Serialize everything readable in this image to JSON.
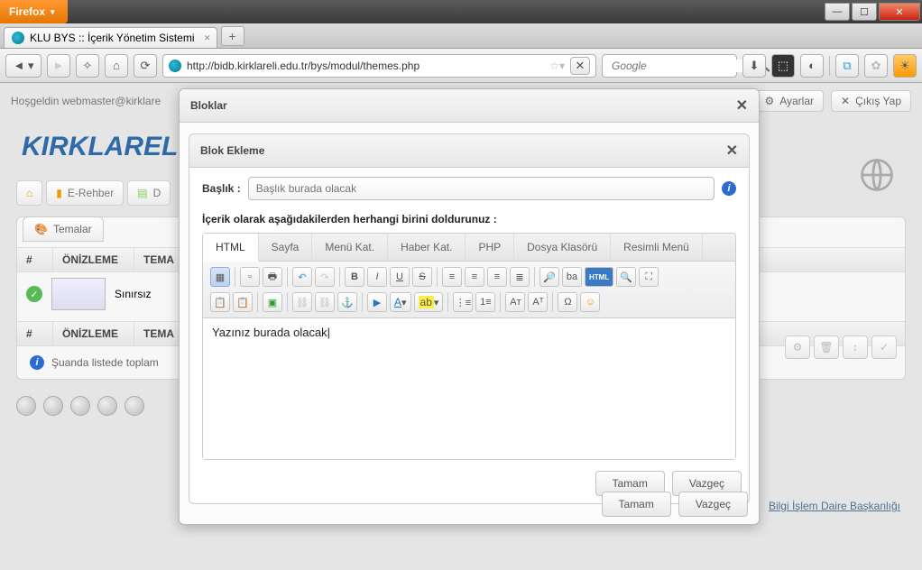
{
  "browser": {
    "name": "Firefox",
    "tab_title": "KLU BYS :: İçerik Yönetim Sistemi",
    "url": "http://bidb.kirklareli.edu.tr/bys/modul/themes.php",
    "search_placeholder": "Google"
  },
  "page": {
    "welcome": "Hoşgeldin webmaster@kirklare",
    "header_buttons": {
      "settings": "Ayarlar",
      "logout": "Çıkış Yap"
    },
    "brand": "KIRKLAREL",
    "nav": {
      "erehber": "E-Rehber",
      "d": "D"
    },
    "tab_label": "Temalar",
    "grid": {
      "cols": [
        "#",
        "ÖNİZLEME",
        "TEMA"
      ],
      "row_name": "Sınırsız"
    },
    "info": "Şuanda listede toplam",
    "footer_link": "Bilgi İşlem Daire Başkanlığı"
  },
  "dialog_outer": {
    "title": "Bloklar",
    "ok": "Tamam",
    "cancel": "Vazgeç"
  },
  "dialog_inner": {
    "title": "Blok Ekleme",
    "label_title": "Başlık :",
    "placeholder_title": "Başlık burada olacak",
    "instruction": "İçerik olarak aşağıdakilerden herhangi birini doldurunuz :",
    "tabs": [
      "HTML",
      "Sayfa",
      "Menü Kat.",
      "Haber Kat.",
      "PHP",
      "Dosya Klasörü",
      "Resimli Menü"
    ],
    "editor_text": "Yazınız burada olacak",
    "ok": "Tamam",
    "cancel": "Vazgeç"
  },
  "editor_buttons": {
    "bold": "B",
    "italic": "I",
    "underline": "U",
    "strike": "S",
    "font_a": "A",
    "bg_a": "ab",
    "a1": "Aт",
    "a2": "Aᵀ",
    "omega": "Ω",
    "html": "HTML",
    "ba": "ba"
  }
}
